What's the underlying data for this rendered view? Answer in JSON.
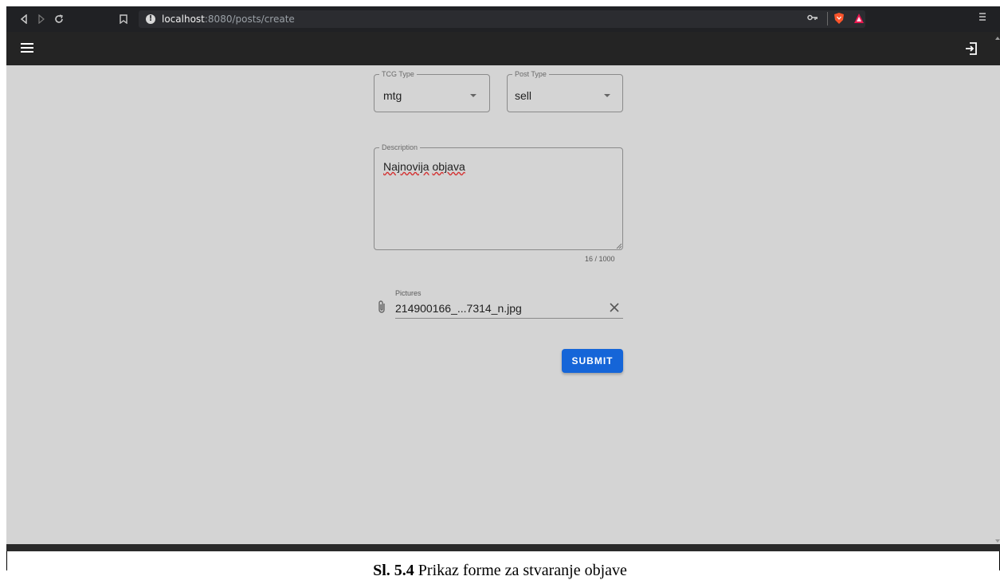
{
  "browser": {
    "url_host": "localhost",
    "url_path": ":8080/posts/create",
    "nav_back_icon": "back-icon",
    "nav_forward_icon": "forward-icon",
    "reload_icon": "reload-icon",
    "bookmark_icon": "bookmark-icon",
    "info_icon": "info-icon",
    "key_icon": "key-icon",
    "brave_icon": "brave-shield-icon",
    "rewards_icon": "brave-rewards-icon",
    "menu_icon": "browser-menu-icon"
  },
  "app_bar": {
    "menu_icon": "hamburger-menu-icon",
    "logout_icon": "logout-icon",
    "background": "#242424"
  },
  "form": {
    "tcg_type": {
      "label": "TCG Type",
      "value": "mtg"
    },
    "post_type": {
      "label": "Post Type",
      "value": "sell"
    },
    "description": {
      "label": "Description",
      "value_word1": "Najnovija",
      "value_word2": "objava",
      "counter": "16 / 1000"
    },
    "pictures": {
      "label": "Pictures",
      "value": "214900166_...7314_n.jpg"
    },
    "submit_label": "SUBMIT",
    "submit_color": "#1565d8"
  },
  "caption": {
    "prefix": "Sl. 5.4",
    "text": " Prikaz forme za stvaranje objave"
  }
}
